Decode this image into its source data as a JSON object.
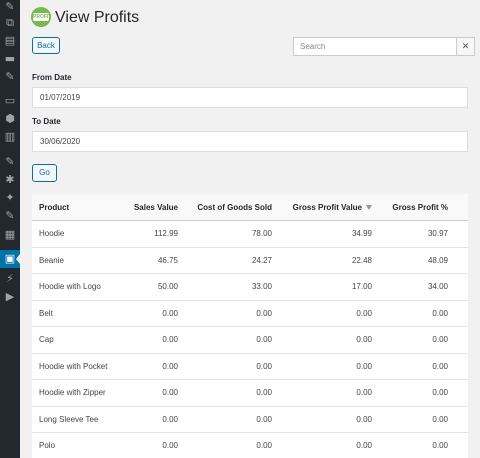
{
  "page": {
    "title": "View Profits",
    "logo_text": "PROFIT"
  },
  "toolbar": {
    "back_label": "Back",
    "go_label": "Go"
  },
  "search": {
    "placeholder": "Search",
    "clear_label": "✕"
  },
  "filters": {
    "from_label": "From Date",
    "from_value": "01/07/2019",
    "to_label": "To Date",
    "to_value": "30/06/2020"
  },
  "table": {
    "headers": {
      "product": "Product",
      "sales": "Sales Value",
      "cogs": "Cost of Goods Sold",
      "gpv": "Gross Profit Value",
      "gpp": "Gross Profit %"
    },
    "rows": [
      {
        "product": "Hoodie",
        "sales": "112.99",
        "cogs": "78.00",
        "gpv": "34.99",
        "gpp": "30.97"
      },
      {
        "product": "Beanie",
        "sales": "46.75",
        "cogs": "24.27",
        "gpv": "22.48",
        "gpp": "48.09"
      },
      {
        "product": "Hoodie with Logo",
        "sales": "50.00",
        "cogs": "33.00",
        "gpv": "17.00",
        "gpp": "34.00"
      },
      {
        "product": "Belt",
        "sales": "0.00",
        "cogs": "0.00",
        "gpv": "0.00",
        "gpp": "0.00"
      },
      {
        "product": "Cap",
        "sales": "0.00",
        "cogs": "0.00",
        "gpv": "0.00",
        "gpp": "0.00"
      },
      {
        "product": "Hoodie with Pocket",
        "sales": "0.00",
        "cogs": "0.00",
        "gpv": "0.00",
        "gpp": "0.00"
      },
      {
        "product": "Hoodie with Zipper",
        "sales": "0.00",
        "cogs": "0.00",
        "gpv": "0.00",
        "gpp": "0.00"
      },
      {
        "product": "Long Sleeve Tee",
        "sales": "0.00",
        "cogs": "0.00",
        "gpv": "0.00",
        "gpp": "0.00"
      },
      {
        "product": "Polo",
        "sales": "0.00",
        "cogs": "0.00",
        "gpv": "0.00",
        "gpp": "0.00"
      }
    ]
  },
  "sidebar": {
    "icons": [
      "pin-icon",
      "media-icon",
      "pages-icon",
      "comments-icon",
      "pin-icon",
      "woocommerce-icon",
      "products-icon",
      "analytics-icon",
      "appearance-icon",
      "plugins-icon",
      "tools-icon",
      "settings-icon",
      "profits-icon",
      "extension-icon",
      "play-icon"
    ],
    "glyphs": [
      "✎",
      "⧉",
      "▤",
      "▬",
      "✎",
      "▭",
      "⬢",
      "▥",
      "✎",
      "✱",
      "✦",
      "▦",
      "▣",
      "⚡",
      "▶"
    ]
  },
  "colors": {
    "accent": "#0073aa",
    "sidebar_bg": "#23282d",
    "logo_green": "#79b84c"
  }
}
